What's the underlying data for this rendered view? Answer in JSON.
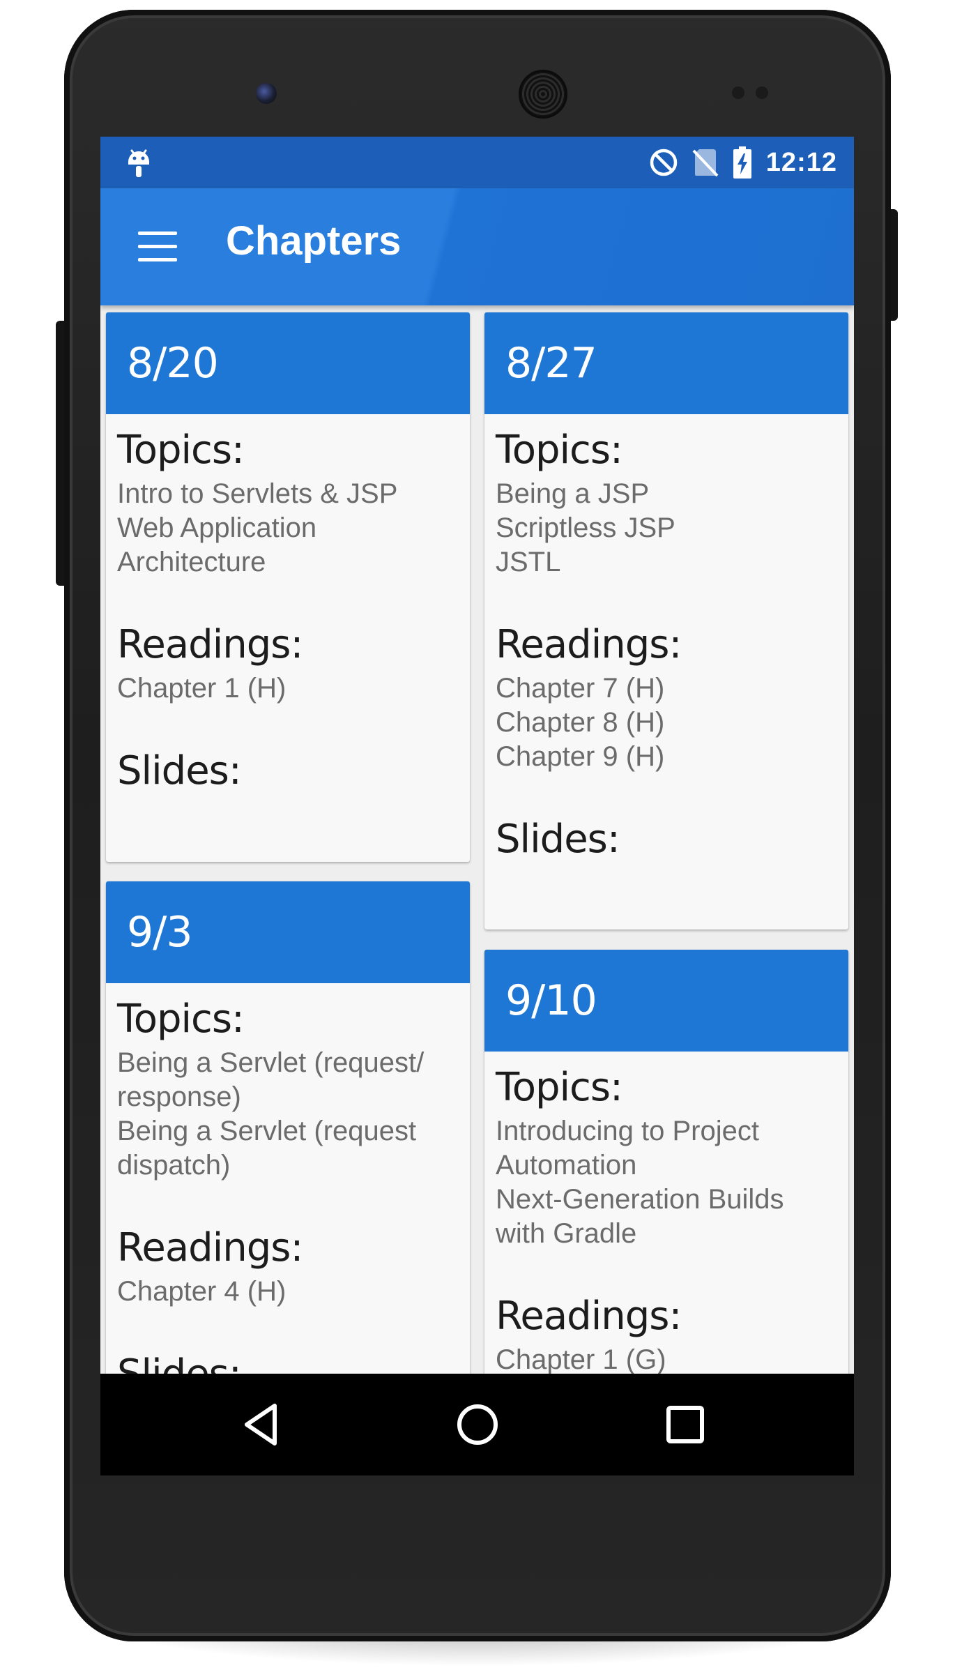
{
  "status_bar": {
    "time": "12:12",
    "icons": [
      "android-icon",
      "do-not-disturb-icon",
      "no-sim-icon",
      "battery-charging-icon"
    ]
  },
  "app_bar": {
    "menu_icon": "hamburger-menu-icon",
    "title": "Chapters"
  },
  "labels": {
    "topics": "Topics:",
    "readings": "Readings:",
    "slides": "Slides:"
  },
  "chapters": [
    {
      "date": "8/20",
      "topics": [
        "Intro to Servlets & JSP",
        "Web Application",
        "Architecture"
      ],
      "readings": [
        "Chapter 1 (H)"
      ]
    },
    {
      "date": "8/27",
      "topics": [
        "Being a JSP",
        "Scriptless JSP",
        "JSTL"
      ],
      "readings": [
        "Chapter 7 (H)",
        "Chapter 8 (H)",
        "Chapter 9 (H)"
      ]
    },
    {
      "date": "9/3",
      "topics": [
        "Being a Servlet (request/",
        "response)",
        "Being a Servlet (request",
        "dispatch)"
      ],
      "readings": [
        "Chapter 4 (H)"
      ]
    },
    {
      "date": "9/10",
      "topics": [
        "Introducing to Project",
        "Automation",
        "Next-Generation Builds",
        "with Gradle"
      ],
      "readings": [
        "Chapter 1 (G)"
      ]
    }
  ],
  "nav_bar": {
    "icons": [
      "back-icon",
      "home-icon",
      "recents-icon"
    ]
  },
  "colors": {
    "status_bar": "#1d5fb8",
    "app_bar": "#2a7fde",
    "card_header": "#1e77d4"
  }
}
